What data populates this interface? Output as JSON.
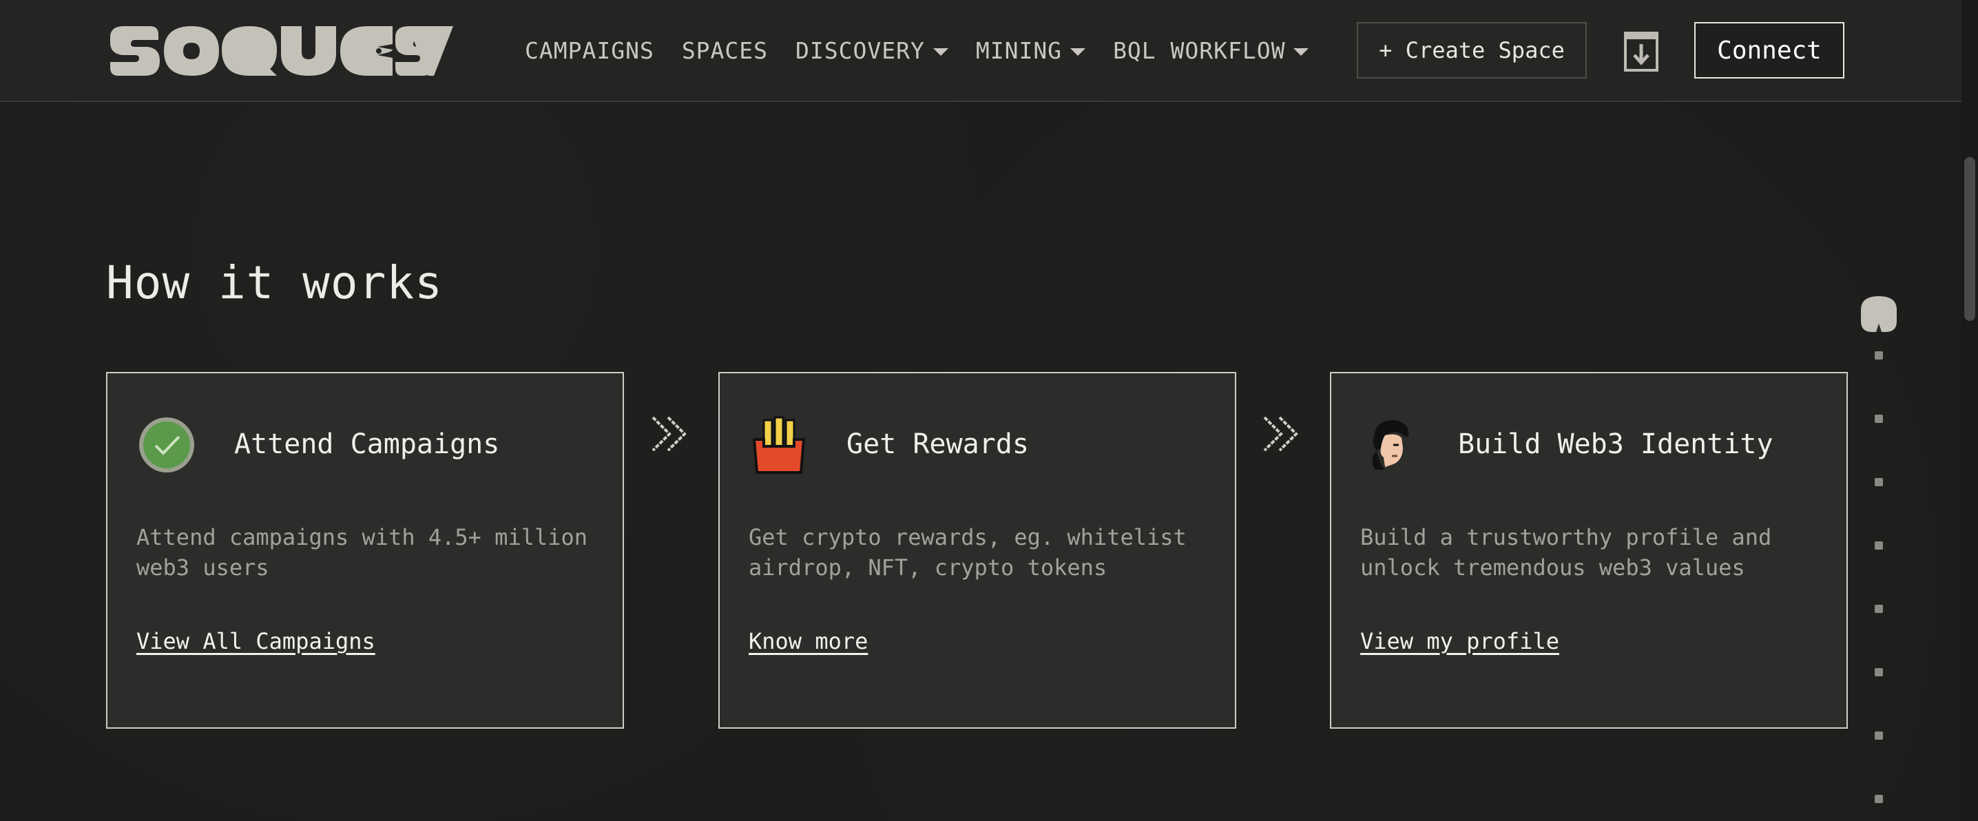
{
  "header": {
    "logo_text": "SOQUEST",
    "nav": [
      {
        "label": "CAMPAIGNS",
        "dropdown": false
      },
      {
        "label": "SPACES",
        "dropdown": false
      },
      {
        "label": "DISCOVERY",
        "dropdown": true
      },
      {
        "label": "MINING",
        "dropdown": true
      },
      {
        "label": "BQL WORKFLOW",
        "dropdown": true
      }
    ],
    "create_space_label": "+ Create Space",
    "download_icon": "download-icon",
    "connect_label": "Connect"
  },
  "section": {
    "title": "How it works",
    "cards": [
      {
        "icon": "check-circle-icon",
        "title": "Attend Campaigns",
        "description": "Attend campaigns with 4.5+ million web3 users",
        "link": "View All Campaigns"
      },
      {
        "icon": "fries-reward-icon",
        "title": "Get Rewards",
        "description": "Get crypto rewards, eg. whitelist airdrop, NFT, crypto tokens",
        "link": "Know more"
      },
      {
        "icon": "avatar-profile-icon",
        "title": "Build Web3 Identity",
        "description": "Build a trustworthy profile and unlock tremendous web3 values",
        "link": "View my profile"
      }
    ]
  },
  "colors": {
    "background": "#1d1d1c",
    "header": "#242423",
    "card": "#2c2c2b",
    "card_border": "#cfcdc6",
    "logo": "#c4c2b8",
    "check_green": "#5a9a4a",
    "reward_red": "#e24a2a",
    "reward_yellow": "#f2d04a"
  }
}
